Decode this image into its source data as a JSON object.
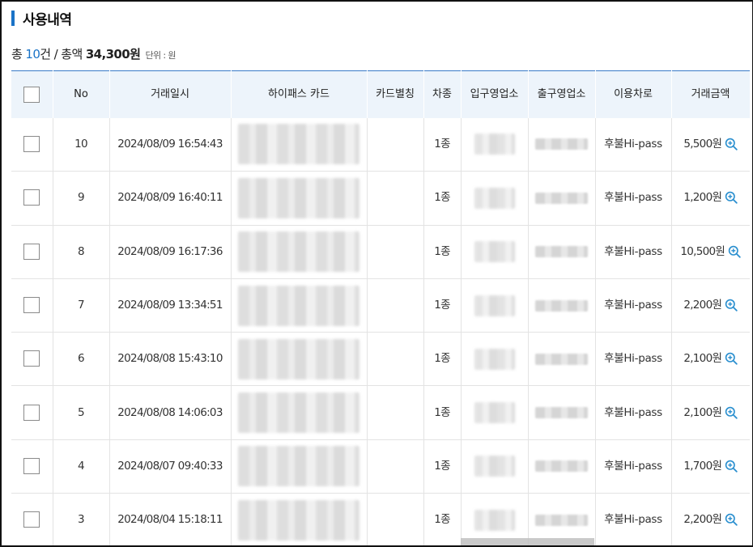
{
  "section": {
    "title": "사용내역"
  },
  "summary": {
    "prefix": "총 ",
    "count": "10",
    "count_suffix": "건 / 총액 ",
    "amount": "34,300원",
    "unit": "단위 : 원"
  },
  "table": {
    "headers": {
      "no": "No",
      "datetime": "거래일시",
      "card": "하이패스 카드",
      "card_alias": "카드별칭",
      "vehicle_class": "차종",
      "entry_office": "입구영업소",
      "exit_office": "출구영업소",
      "lane": "이용차로",
      "amount": "거래금액"
    },
    "rows": [
      {
        "no": "10",
        "datetime": "2024/08/09 16:54:43",
        "vehicle_class": "1종",
        "lane": "후불Hi-pass",
        "amount": "5,500원"
      },
      {
        "no": "9",
        "datetime": "2024/08/09 16:40:11",
        "vehicle_class": "1종",
        "lane": "후불Hi-pass",
        "amount": "1,200원"
      },
      {
        "no": "8",
        "datetime": "2024/08/09 16:17:36",
        "vehicle_class": "1종",
        "lane": "후불Hi-pass",
        "amount": "10,500원"
      },
      {
        "no": "7",
        "datetime": "2024/08/09 13:34:51",
        "vehicle_class": "1종",
        "lane": "후불Hi-pass",
        "amount": "2,200원"
      },
      {
        "no": "6",
        "datetime": "2024/08/08 15:43:10",
        "vehicle_class": "1종",
        "lane": "후불Hi-pass",
        "amount": "2,100원"
      },
      {
        "no": "5",
        "datetime": "2024/08/08 14:06:03",
        "vehicle_class": "1종",
        "lane": "후불Hi-pass",
        "amount": "2,100원"
      },
      {
        "no": "4",
        "datetime": "2024/08/07 09:40:33",
        "vehicle_class": "1종",
        "lane": "후불Hi-pass",
        "amount": "1,700원"
      },
      {
        "no": "3",
        "datetime": "2024/08/04 15:18:11",
        "vehicle_class": "1종",
        "lane": "후불Hi-pass",
        "amount": "2,200원"
      }
    ]
  },
  "colors": {
    "accent": "#1a73c7",
    "header_bg": "#edf4fb",
    "header_border": "#3a7bc8"
  },
  "icons": {
    "detail": "zoom-in-icon"
  }
}
